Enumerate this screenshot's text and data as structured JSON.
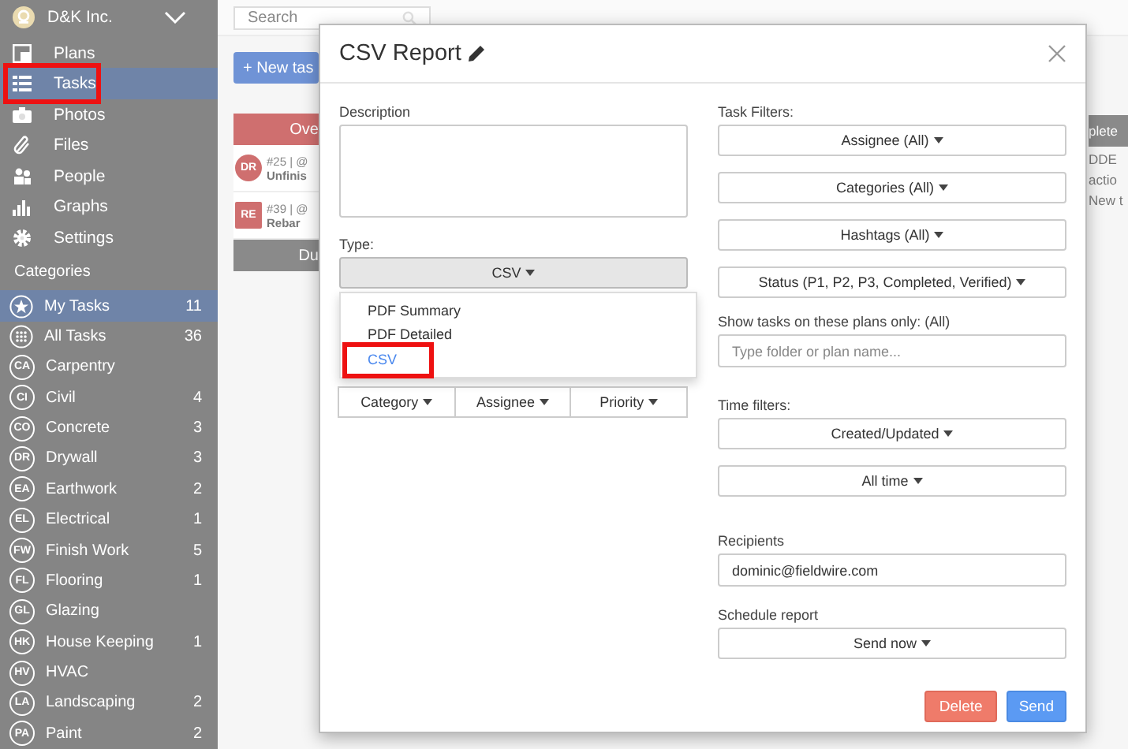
{
  "sidebar": {
    "org_name": "D&K Inc.",
    "nav": [
      {
        "label": "Plans",
        "kind": "plans",
        "selected": false,
        "highlighted": false
      },
      {
        "label": "Tasks",
        "kind": "tasks",
        "selected": true,
        "highlighted": true
      },
      {
        "label": "Photos",
        "kind": "photos",
        "selected": false,
        "highlighted": false
      },
      {
        "label": "Files",
        "kind": "files",
        "selected": false,
        "highlighted": false
      },
      {
        "label": "People",
        "kind": "people",
        "selected": false,
        "highlighted": false
      },
      {
        "label": "Graphs",
        "kind": "graphs",
        "selected": false,
        "highlighted": false
      },
      {
        "label": "Settings",
        "kind": "settings",
        "selected": false,
        "highlighted": false
      }
    ],
    "section_label": "Categories",
    "categories": [
      {
        "label": "My Tasks",
        "kind": "star",
        "count": "11",
        "selected": true
      },
      {
        "label": "All Tasks",
        "kind": "grid",
        "count": "36",
        "selected": false
      },
      {
        "label": "Carpentry",
        "kind": "abbr",
        "abbr": "CA",
        "selected": false
      },
      {
        "label": "Civil",
        "kind": "abbr",
        "abbr": "CI",
        "count": "4",
        "selected": false
      },
      {
        "label": "Concrete",
        "kind": "abbr",
        "abbr": "CO",
        "count": "3",
        "selected": false
      },
      {
        "label": "Drywall",
        "kind": "abbr",
        "abbr": "DR",
        "count": "3",
        "selected": false
      },
      {
        "label": "Earthwork",
        "kind": "abbr",
        "abbr": "EA",
        "count": "2",
        "selected": false
      },
      {
        "label": "Electrical",
        "kind": "abbr",
        "abbr": "EL",
        "count": "1",
        "selected": false
      },
      {
        "label": "Finish Work",
        "kind": "abbr",
        "abbr": "FW",
        "count": "5",
        "selected": false
      },
      {
        "label": "Flooring",
        "kind": "abbr",
        "abbr": "FL",
        "count": "1",
        "selected": false
      },
      {
        "label": "Glazing",
        "kind": "abbr",
        "abbr": "GL",
        "selected": false
      },
      {
        "label": "House Keeping",
        "kind": "abbr",
        "abbr": "HK",
        "count": "1",
        "selected": false
      },
      {
        "label": "HVAC",
        "kind": "abbr",
        "abbr": "HV",
        "selected": false
      },
      {
        "label": "Landscaping",
        "kind": "abbr",
        "abbr": "LA",
        "count": "2",
        "selected": false
      },
      {
        "label": "Paint",
        "kind": "abbr",
        "abbr": "PA",
        "count": "2",
        "selected": false
      }
    ]
  },
  "background": {
    "search": {
      "placeholder": "Search"
    },
    "new_task_button": "+ New tas",
    "overdue_header": "Ove",
    "tasks": [
      {
        "kind": "pin",
        "avatar": "DR",
        "meta": "#25 | @",
        "title": "Unfinis"
      },
      {
        "kind": "square",
        "avatar": "RE",
        "meta": "#39 | @",
        "title": "Rebar"
      }
    ],
    "due_header": "Du",
    "right_header": "plete",
    "right_lines": [
      "DDE",
      "actio",
      "New t"
    ]
  },
  "dialog": {
    "title": "CSV Report",
    "description": {
      "label": "Description"
    },
    "type": {
      "label": "Type:",
      "value": "CSV",
      "menu": [
        {
          "label": "PDF Summary",
          "selected": false,
          "highlighted": false
        },
        {
          "label": "PDF Detailed",
          "selected": false,
          "highlighted": false
        },
        {
          "label": "CSV",
          "selected": true,
          "highlighted": true
        }
      ]
    },
    "group_by": [
      "Category",
      "Assignee",
      "Priority"
    ],
    "task_filters": {
      "label": "Task Filters:",
      "dropdowns": [
        "Assignee (All)",
        "Categories (All)",
        "Hashtags (All)",
        "Status (P1, P2, P3, Completed, Verified)"
      ]
    },
    "plans_filter": {
      "label": "Show tasks on these plans only: (All)",
      "placeholder": "Type folder or plan name..."
    },
    "time_filters": {
      "label": "Time filters:",
      "dropdowns": [
        "Created/Updated",
        "All time"
      ]
    },
    "recipients": {
      "label": "Recipients",
      "value": "dominic@fieldwire.com"
    },
    "schedule": {
      "label": "Schedule report",
      "value": "Send now"
    },
    "buttons": [
      {
        "label": "Delete",
        "kind": "danger"
      },
      {
        "label": "Send",
        "kind": "primary"
      }
    ]
  }
}
